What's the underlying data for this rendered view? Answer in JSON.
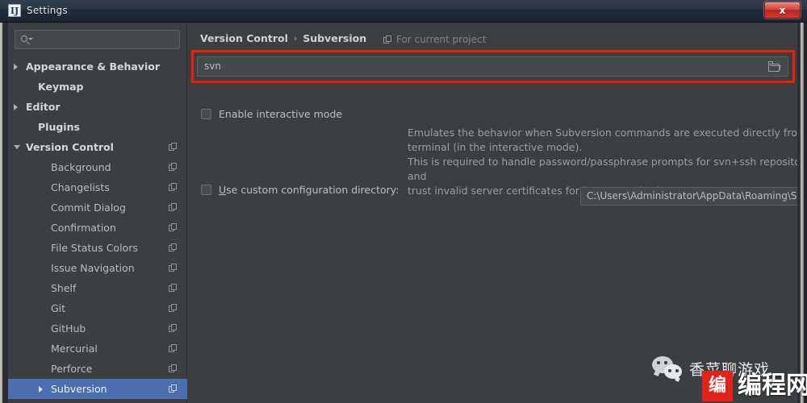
{
  "window": {
    "title": "Settings",
    "app_icon": "idea-icon",
    "close_label": "x"
  },
  "sidebar": {
    "search": {
      "value": "",
      "placeholder": ""
    },
    "items": [
      {
        "label": "Appearance & Behavior",
        "indent": 22,
        "arrow": "right",
        "bold": true,
        "copy": false,
        "selected": false
      },
      {
        "label": "Keymap",
        "indent": 37,
        "arrow": "none",
        "bold": true,
        "copy": false,
        "selected": false
      },
      {
        "label": "Editor",
        "indent": 22,
        "arrow": "right",
        "bold": true,
        "copy": false,
        "selected": false
      },
      {
        "label": "Plugins",
        "indent": 37,
        "arrow": "none",
        "bold": true,
        "copy": false,
        "selected": false
      },
      {
        "label": "Version Control",
        "indent": 22,
        "arrow": "down",
        "bold": true,
        "copy": true,
        "selected": false
      },
      {
        "label": "Background",
        "indent": 53,
        "arrow": "none",
        "bold": false,
        "copy": true,
        "selected": false
      },
      {
        "label": "Changelists",
        "indent": 53,
        "arrow": "none",
        "bold": false,
        "copy": true,
        "selected": false
      },
      {
        "label": "Commit Dialog",
        "indent": 53,
        "arrow": "none",
        "bold": false,
        "copy": true,
        "selected": false
      },
      {
        "label": "Confirmation",
        "indent": 53,
        "arrow": "none",
        "bold": false,
        "copy": true,
        "selected": false
      },
      {
        "label": "File Status Colors",
        "indent": 53,
        "arrow": "none",
        "bold": false,
        "copy": true,
        "selected": false
      },
      {
        "label": "Issue Navigation",
        "indent": 53,
        "arrow": "none",
        "bold": false,
        "copy": true,
        "selected": false
      },
      {
        "label": "Shelf",
        "indent": 53,
        "arrow": "none",
        "bold": false,
        "copy": true,
        "selected": false
      },
      {
        "label": "Git",
        "indent": 53,
        "arrow": "none",
        "bold": false,
        "copy": true,
        "selected": false
      },
      {
        "label": "GitHub",
        "indent": 53,
        "arrow": "none",
        "bold": false,
        "copy": true,
        "selected": false
      },
      {
        "label": "Mercurial",
        "indent": 53,
        "arrow": "none",
        "bold": false,
        "copy": true,
        "selected": false
      },
      {
        "label": "Perforce",
        "indent": 53,
        "arrow": "none",
        "bold": false,
        "copy": true,
        "selected": false
      },
      {
        "label": "Subversion",
        "indent": 53,
        "arrow": "right",
        "bold": false,
        "copy": true,
        "selected": true
      }
    ]
  },
  "content": {
    "breadcrumb": {
      "parent": "Version Control",
      "separator": "›",
      "current": "Subversion"
    },
    "for_current_project": "For current project",
    "svn_field": {
      "value": "svn",
      "browse_icon": "folder-icon",
      "highlighted": true,
      "highlight_color": "#f01d0d"
    },
    "interactive_mode": {
      "label": "Enable interactive mode",
      "checked": false,
      "description_lines": [
        "Emulates the behavior when Subversion commands are executed directly from the",
        "terminal (in the interactive mode).",
        "This is required to handle password/passphrase prompts for svn+ssh repositories, and",
        "trust invalid server certificates for https repositories."
      ]
    },
    "custom_config": {
      "label_prefix": "U",
      "label_rest": "se custom configuration directory:",
      "checked": false,
      "path_value": "C:\\Users\\Administrator\\AppData\\Roaming\\Subversion",
      "browse_icon": "folder-icon"
    }
  },
  "watermark": {
    "wechat_icon": "wechat-icon",
    "account_name": "香菜聊游戏",
    "logo_mark": "编",
    "logo_word": "编程网",
    "logo_color": "#e2231a"
  }
}
